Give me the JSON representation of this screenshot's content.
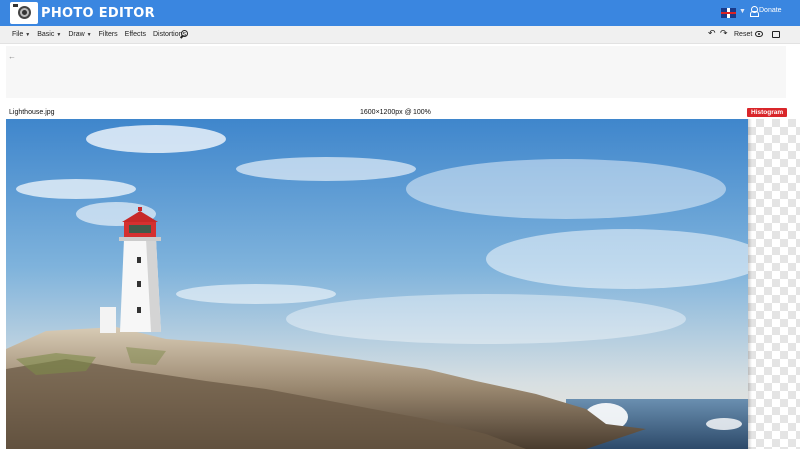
{
  "header": {
    "app_title": "PHOTO EDITOR",
    "donate_label": "Donate",
    "language_icon": "uk-flag-icon"
  },
  "toolbar": {
    "menus": [
      {
        "label": "File",
        "has_caret": true
      },
      {
        "label": "Basic",
        "has_caret": true
      },
      {
        "label": "Draw",
        "has_caret": true
      },
      {
        "label": "Filters",
        "has_caret": false
      },
      {
        "label": "Effects",
        "has_caret": false
      },
      {
        "label": "Distortions",
        "has_caret": false
      }
    ],
    "reset_label": "Reset"
  },
  "image_info": {
    "filename": "Lighthouse.jpg",
    "dimensions": "1600×1200px @",
    "zoom": "100%",
    "histogram_label": "Histogram"
  },
  "colors": {
    "header_bg": "#3a86e0",
    "histogram_bg": "#d9262a"
  }
}
